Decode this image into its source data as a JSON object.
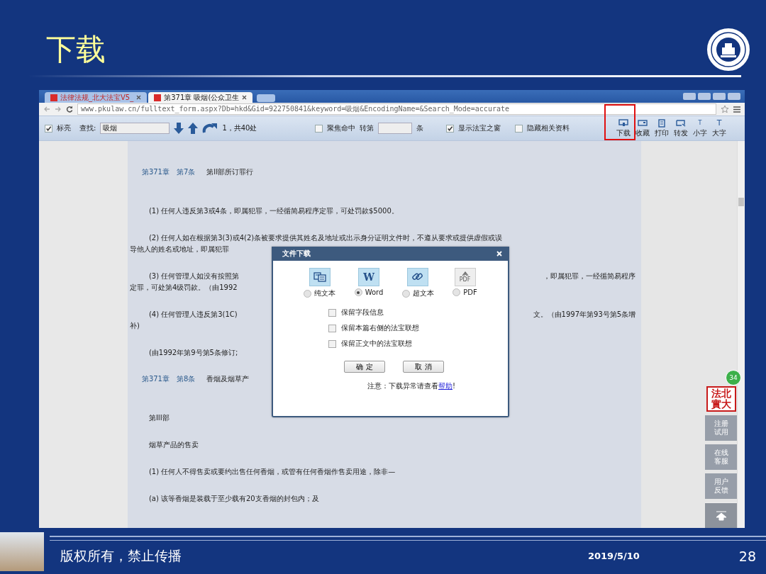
{
  "slide": {
    "title": "下载"
  },
  "browser": {
    "tabs": [
      {
        "label": "法律法规_北大法宝V5_",
        "selected": false
      },
      {
        "label": "第371章 吸烟(公众卫生",
        "selected": true
      }
    ],
    "address": "www.pkulaw.cn/fulltext_form.aspx?Db=hkd&Gid=922750841&keyword=吸烟&EncodingName=&Search_Mode=accurate",
    "toolbar": {
      "highlight": {
        "label": "标亮",
        "checked": true
      },
      "find_label": "查找:",
      "find_value": "吸烟",
      "match_count": "1，共40处",
      "focus": {
        "label": "聚焦命中",
        "checked": false
      },
      "goto_label": "转第",
      "goto_suffix": "条",
      "show_window": {
        "label": "显示法宝之窗",
        "checked": true
      },
      "hide_related": {
        "label": "隐藏相关资料",
        "checked": false
      },
      "tools": [
        {
          "kind": "download",
          "label": "下载",
          "marked": true
        },
        {
          "kind": "favorite",
          "label": "收藏",
          "marked": false
        },
        {
          "kind": "print",
          "label": "打印",
          "marked": false
        },
        {
          "kind": "forward",
          "label": "转发",
          "marked": false
        },
        {
          "kind": "small",
          "label": "小字",
          "icon_text": "T",
          "marked": false
        },
        {
          "kind": "large",
          "label": "大字",
          "icon_text": "T",
          "marked": false
        }
      ]
    },
    "document": {
      "blocks": [
        {
          "kind": "heading",
          "chapter": "第371章",
          "section": "第7条",
          "title": "第II部所订罪行"
        },
        {
          "kind": "para",
          "lines": [
            {
              "left": "(1) 任何人违反第3或4条，即属犯罪，一经循简易程序定罪，可处罚款$5000。"
            }
          ]
        },
        {
          "kind": "para",
          "lines": [
            {
              "left": "(2) 任何人如在根据第3(3)或4(2)条被要求提供其姓名及地址或出示身分证明文件时，不遵从要求或提供虚假或误"
            },
            {
              "left": "导他人的姓名或地址，即属犯罪"
            }
          ]
        },
        {
          "kind": "para",
          "lines": [
            {
              "left": "(3) 任何管理人如没有按照第",
              "right": "，即属犯罪，一经循简易程序"
            },
            {
              "left": "定罪，可处第4级罚款。（由1992"
            }
          ]
        },
        {
          "kind": "para",
          "lines": [
            {
              "left": "(4) 任何管理人违反第3(1C)",
              "right": "文。（由1997年第93号第5条增"
            },
            {
              "left": "补)"
            }
          ]
        },
        {
          "kind": "para",
          "lines": [
            {
              "left": "(由1992年第9号第5条修订;"
            }
          ]
        },
        {
          "kind": "heading",
          "chapter": "第371章",
          "section": "第8条",
          "title": "香烟及烟草产"
        },
        {
          "kind": "para",
          "lines": [
            {
              "left": "第III部"
            }
          ]
        },
        {
          "kind": "para",
          "lines": [
            {
              "left": "烟草产品的售卖"
            }
          ]
        },
        {
          "kind": "para",
          "lines": [
            {
              "left": "(1) 任何人不得售卖或要约出售任何香烟，或管有任何香烟作售卖用途，除非—"
            }
          ]
        },
        {
          "kind": "para",
          "lines": [
            {
              "left": "(a) 该等香烟是装载于至少载有20支香烟的封包内；及"
            }
          ]
        }
      ]
    },
    "dialog": {
      "title": "文件下载",
      "formats": [
        {
          "kind": "plain",
          "label": "纯文本",
          "selected": false
        },
        {
          "kind": "word",
          "label": "Word",
          "icon_text": "W",
          "selected": true
        },
        {
          "kind": "hypertext",
          "label": "超文本",
          "selected": false
        },
        {
          "kind": "pdf",
          "label": "PDF",
          "icon_text": "PDF",
          "selected": false
        }
      ],
      "options": [
        {
          "label": "保留字段信息",
          "checked": false
        },
        {
          "label": "保留本篇右侧的法宝联想",
          "checked": false
        },
        {
          "label": "保留正文中的法宝联想",
          "checked": false
        }
      ],
      "buttons": [
        "确 定",
        "取 消"
      ],
      "note": {
        "text": "注意：下载异常请查看",
        "link": "帮助",
        "suffix": "!"
      }
    },
    "side_panel": {
      "badge": "34",
      "logo_lines": [
        "法北",
        "實大"
      ],
      "buttons": [
        {
          "kind": "text",
          "label": "注册试用"
        },
        {
          "kind": "text",
          "label": "在线客服"
        },
        {
          "kind": "text",
          "label": "用户反馈"
        },
        {
          "kind": "top"
        }
      ]
    }
  },
  "footer": {
    "copyright": "版权所有，禁止传播",
    "date": "2019/5/10",
    "page": "28"
  }
}
